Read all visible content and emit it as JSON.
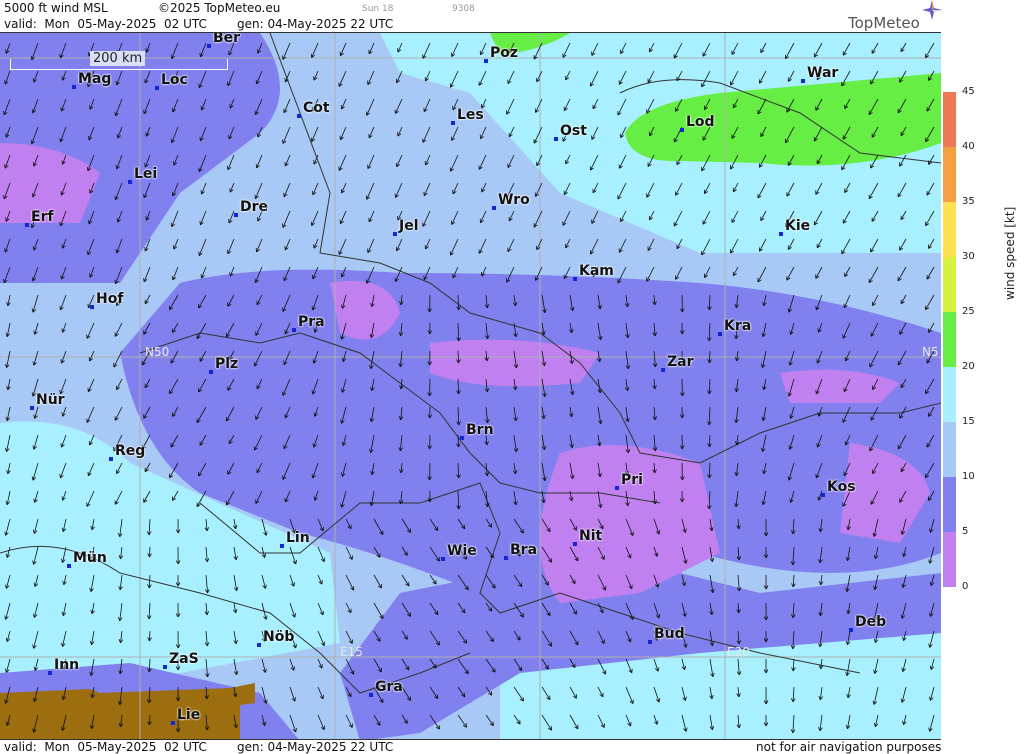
{
  "header": {
    "product": "5000 ft wind MSL",
    "copyright": "©2025 TopMeteo.eu",
    "sun": "Sun 18",
    "code": "9308",
    "valid": "valid:  Mon  05-May-2025  02 UTC",
    "gen": "gen: 04-May-2025 22 UTC"
  },
  "logo": {
    "text": "TopMeteo",
    "icon": "compass-star-icon"
  },
  "scale": {
    "label": "200 km"
  },
  "grid_labels": {
    "n50_left": "N50",
    "n50_right": "N5",
    "e15": "E15",
    "e20": "E20"
  },
  "cities": [
    {
      "name": "Ber"
    },
    {
      "name": "Poz"
    },
    {
      "name": "War"
    },
    {
      "name": "Mag"
    },
    {
      "name": "Loc"
    },
    {
      "name": "Cot"
    },
    {
      "name": "Les"
    },
    {
      "name": "Lod"
    },
    {
      "name": "Ost"
    },
    {
      "name": "Lei"
    },
    {
      "name": "Erf"
    },
    {
      "name": "Dre"
    },
    {
      "name": "Jel"
    },
    {
      "name": "Wro"
    },
    {
      "name": "Kie"
    },
    {
      "name": "Kam"
    },
    {
      "name": "Hof"
    },
    {
      "name": "Pra"
    },
    {
      "name": "Kra"
    },
    {
      "name": "Zar"
    },
    {
      "name": "Plz"
    },
    {
      "name": "Nür"
    },
    {
      "name": "Brn"
    },
    {
      "name": "Reg"
    },
    {
      "name": "Pri"
    },
    {
      "name": "Kos"
    },
    {
      "name": "Lin"
    },
    {
      "name": "Nit"
    },
    {
      "name": "Mün"
    },
    {
      "name": "Wie"
    },
    {
      "name": "Bra"
    },
    {
      "name": "Deb"
    },
    {
      "name": "Nöb"
    },
    {
      "name": "Bud"
    },
    {
      "name": "Inn"
    },
    {
      "name": "ZaS"
    },
    {
      "name": "Gra"
    },
    {
      "name": "Lie"
    }
  ],
  "legend": {
    "title": "wind  speed  [kt]",
    "ticks": [
      "45",
      "40",
      "35",
      "30",
      "25",
      "20",
      "15",
      "10",
      "5",
      "0"
    ],
    "colors": [
      "#ee7755",
      "#ee8844",
      "#f5b340",
      "#fff04a",
      "#c8ee44",
      "#44dd33",
      "#a8f0ff",
      "#a8c8f5",
      "#8080ee",
      "#c080f0"
    ]
  },
  "footer": {
    "valid": "valid:  Mon  05-May-2025  02 UTC",
    "gen": "gen: 04-May-2025 22 UTC",
    "disclaimer": "not for air navigation purposes"
  }
}
